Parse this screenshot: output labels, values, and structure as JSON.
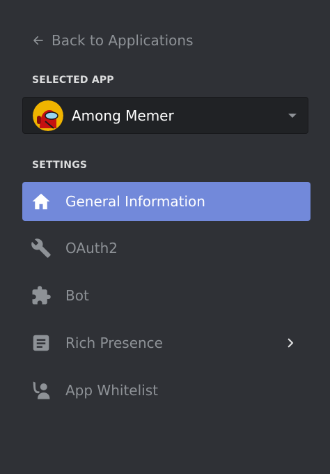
{
  "back": {
    "label": "Back to Applications",
    "icon": "arrow-left-icon"
  },
  "selected_app": {
    "section_label": "SELECTED APP",
    "name": "Among Memer",
    "avatar_colors": {
      "bg": "#f0b400",
      "body": "#c51111",
      "visor": "#9ad6f0"
    }
  },
  "settings": {
    "section_label": "SETTINGS",
    "items": [
      {
        "label": "General Information",
        "icon": "home-icon",
        "active": true
      },
      {
        "label": "OAuth2",
        "icon": "wrench-icon",
        "active": false
      },
      {
        "label": "Bot",
        "icon": "puzzle-icon",
        "active": false
      },
      {
        "label": "Rich Presence",
        "icon": "document-icon",
        "active": false,
        "has_submenu": true
      },
      {
        "label": "App Whitelist",
        "icon": "user-shield-icon",
        "active": false
      }
    ]
  },
  "colors": {
    "background": "#2f3136",
    "accent": "#7289da",
    "muted_text": "#8e9297",
    "heading_text": "#dcddde"
  }
}
